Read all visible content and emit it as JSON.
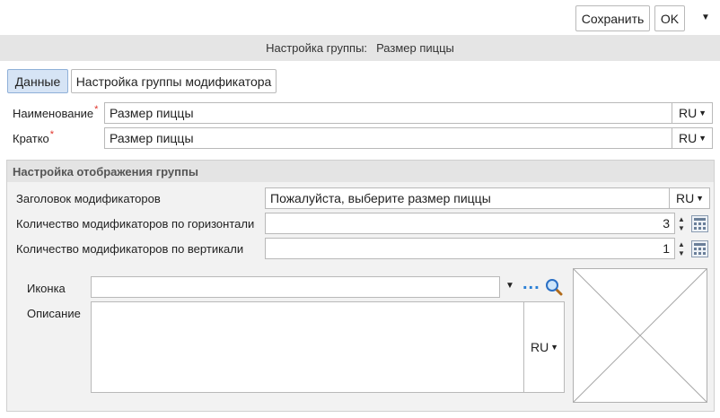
{
  "toolbar": {
    "save_label": "Сохранить",
    "ok_label": "OK",
    "menu_caret": "▼"
  },
  "header": {
    "prefix": "Настройка группы:",
    "group_name": "Размер пиццы"
  },
  "tabs": [
    {
      "label": "Данные",
      "active": true
    },
    {
      "label": "Настройка группы модификатора",
      "active": false
    }
  ],
  "form": {
    "name": {
      "label": "Наименование",
      "required_mark": "*",
      "value": "Размер пиццы",
      "lang": "RU"
    },
    "short": {
      "label": "Кратко",
      "required_mark": "*",
      "value": "Размер пиццы",
      "lang": "RU"
    }
  },
  "display_group": {
    "title": "Настройка отображения группы",
    "header_field": {
      "label": "Заголовок модификаторов",
      "value": "Пожалуйста, выберите размер пиццы",
      "lang": "RU"
    },
    "horizontal": {
      "label": "Количество модификаторов по горизонтали",
      "value": "3"
    },
    "vertical": {
      "label": "Количество модификаторов по вертикали",
      "value": "1"
    },
    "icon": {
      "label": "Иконка",
      "value": "",
      "dots": "..."
    },
    "description": {
      "label": "Описание",
      "value": "",
      "lang": "RU"
    }
  },
  "colors": {
    "title_bar": "#e5e5e5",
    "active_tab": "#d6e4f5",
    "required": "#e0332a",
    "dots": "#2a7fd6"
  }
}
